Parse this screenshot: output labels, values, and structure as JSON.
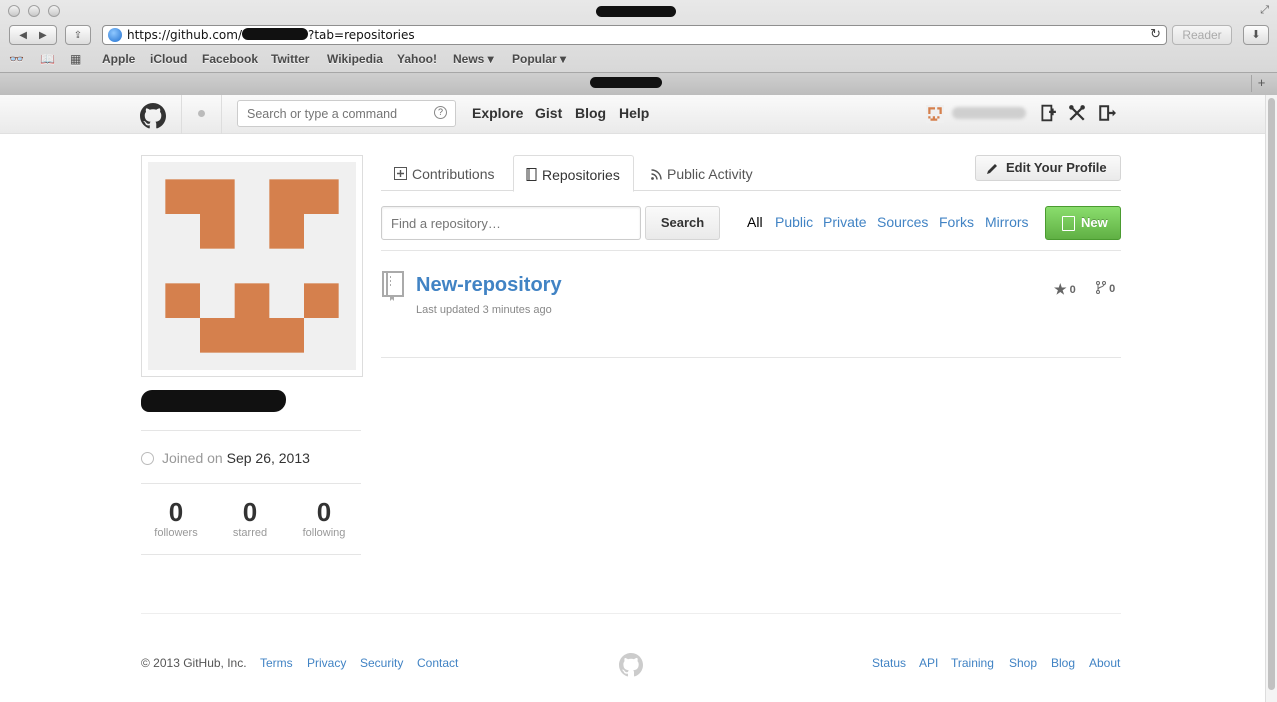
{
  "browser": {
    "url_prefix": "https://github.com/",
    "url_suffix": "?tab=repositories",
    "reader_label": "Reader",
    "bookmarks": [
      "Apple",
      "iCloud",
      "Facebook",
      "Twitter",
      "Wikipedia",
      "Yahoo!",
      "News ▾",
      "Popular ▾"
    ]
  },
  "header": {
    "search_placeholder": "Search or type a command",
    "search_help": "?",
    "nav": [
      "Explore",
      "Gist",
      "Blog",
      "Help"
    ]
  },
  "profile": {
    "joined_label": "Joined on",
    "joined_date": "Sep 26, 2013",
    "stats": [
      {
        "value": "0",
        "label": "followers"
      },
      {
        "value": "0",
        "label": "starred"
      },
      {
        "value": "0",
        "label": "following"
      }
    ],
    "avatar_color": "#d5804d"
  },
  "tabs": [
    "Contributions",
    "Repositories",
    "Public Activity"
  ],
  "edit_profile_label": "Edit Your Profile",
  "repo_search": {
    "placeholder": "Find a repository…",
    "button": "Search"
  },
  "filters": [
    "All",
    "Public",
    "Private",
    "Sources",
    "Forks",
    "Mirrors"
  ],
  "new_button": "New",
  "repo": {
    "name": "New-repository",
    "updated": "Last updated 3 minutes ago",
    "stars": "0",
    "forks": "0"
  },
  "footer": {
    "copyright": "© 2013 GitHub, Inc.",
    "left_links": [
      "Terms",
      "Privacy",
      "Security",
      "Contact"
    ],
    "right_links": [
      "Status",
      "API",
      "Training",
      "Shop",
      "Blog",
      "About"
    ]
  },
  "colors": {
    "link": "#4183c4",
    "new_button": "#60b044"
  }
}
